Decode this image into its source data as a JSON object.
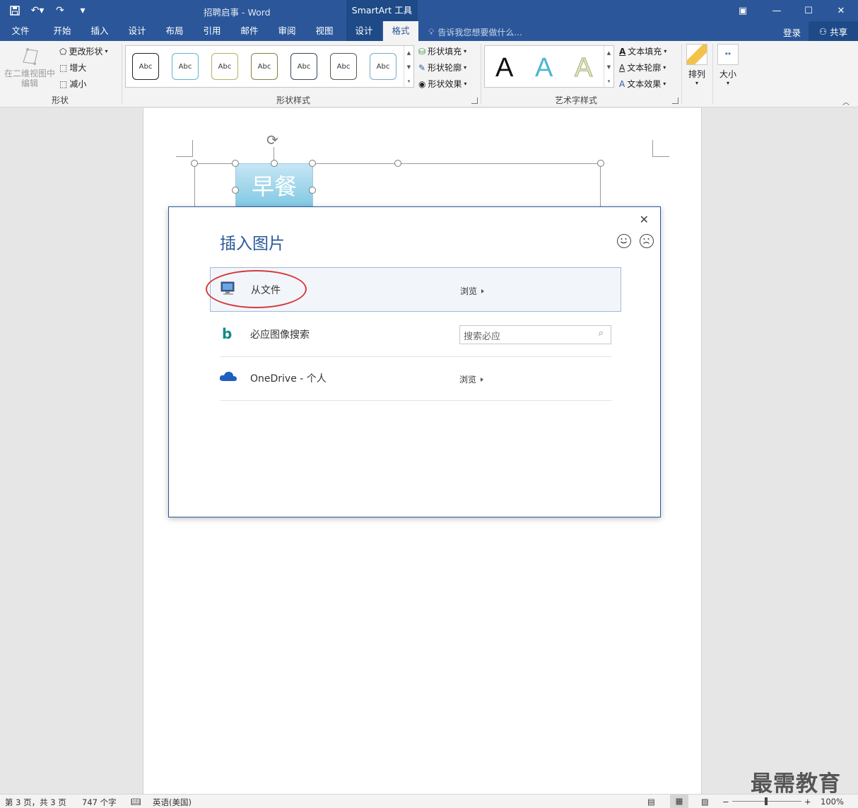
{
  "titlebar": {
    "doc_title": "招聘启事 - Word",
    "context_title": "SmartArt 工具"
  },
  "tabs": [
    "文件",
    "开始",
    "插入",
    "设计",
    "布局",
    "引用",
    "邮件",
    "审阅",
    "视图",
    "设计",
    "格式"
  ],
  "tellme": "告诉我您想要做什么...",
  "account": {
    "login": "登录",
    "share": "共享"
  },
  "ribbon": {
    "shape_group": {
      "edit_2d": "在二维视图中\n编辑",
      "change_shape": "更改形状",
      "larger": "增大",
      "smaller": "减小",
      "label": "形状"
    },
    "shape_styles": {
      "swatch_text": "Abc",
      "fill": "形状填充",
      "outline": "形状轮廓",
      "effects": "形状效果",
      "label": "形状样式"
    },
    "wordart": {
      "sample": "A",
      "fill": "文本填充",
      "outline": "文本轮廓",
      "effects": "文本效果",
      "label": "艺术字样式"
    },
    "arrange": "排列",
    "size": "大小"
  },
  "document": {
    "smartart_text": "早餐"
  },
  "dialog": {
    "title": "插入图片",
    "sources": [
      {
        "label": "从文件",
        "action": "浏览"
      },
      {
        "label": "必应图像搜索",
        "placeholder": "搜索必应"
      },
      {
        "label": "OneDrive - 个人",
        "action": "浏览"
      }
    ]
  },
  "status": {
    "page": "第 3 页，共 3 页",
    "words": "747 个字",
    "language": "英语(美国)",
    "zoom": "100%"
  },
  "watermark": "最需教育",
  "colors": {
    "accent": "#2b579a",
    "context": "#1e4a87",
    "highlight": "#d63b3b"
  }
}
